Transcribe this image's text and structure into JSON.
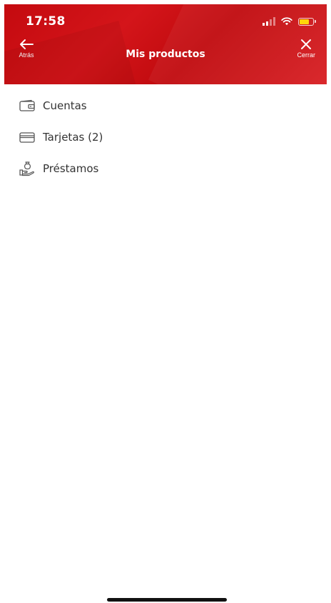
{
  "status_bar": {
    "time": "17:58",
    "signal_icon": "cellular-signal-icon",
    "wifi_icon": "wifi-icon",
    "battery_icon": "battery-icon",
    "battery_color": "#ffd60a"
  },
  "nav": {
    "title": "Mis productos",
    "back_label": "Atrás",
    "back_icon": "arrow-left-icon",
    "close_label": "Cerrar",
    "close_icon": "close-icon",
    "background_color": "#c8102e"
  },
  "products": [
    {
      "label": "Cuentas",
      "icon": "wallet-icon"
    },
    {
      "label": "Tarjetas (2)",
      "icon": "credit-card-icon"
    },
    {
      "label": "Préstamos",
      "icon": "loan-hand-money-bag-icon"
    }
  ]
}
